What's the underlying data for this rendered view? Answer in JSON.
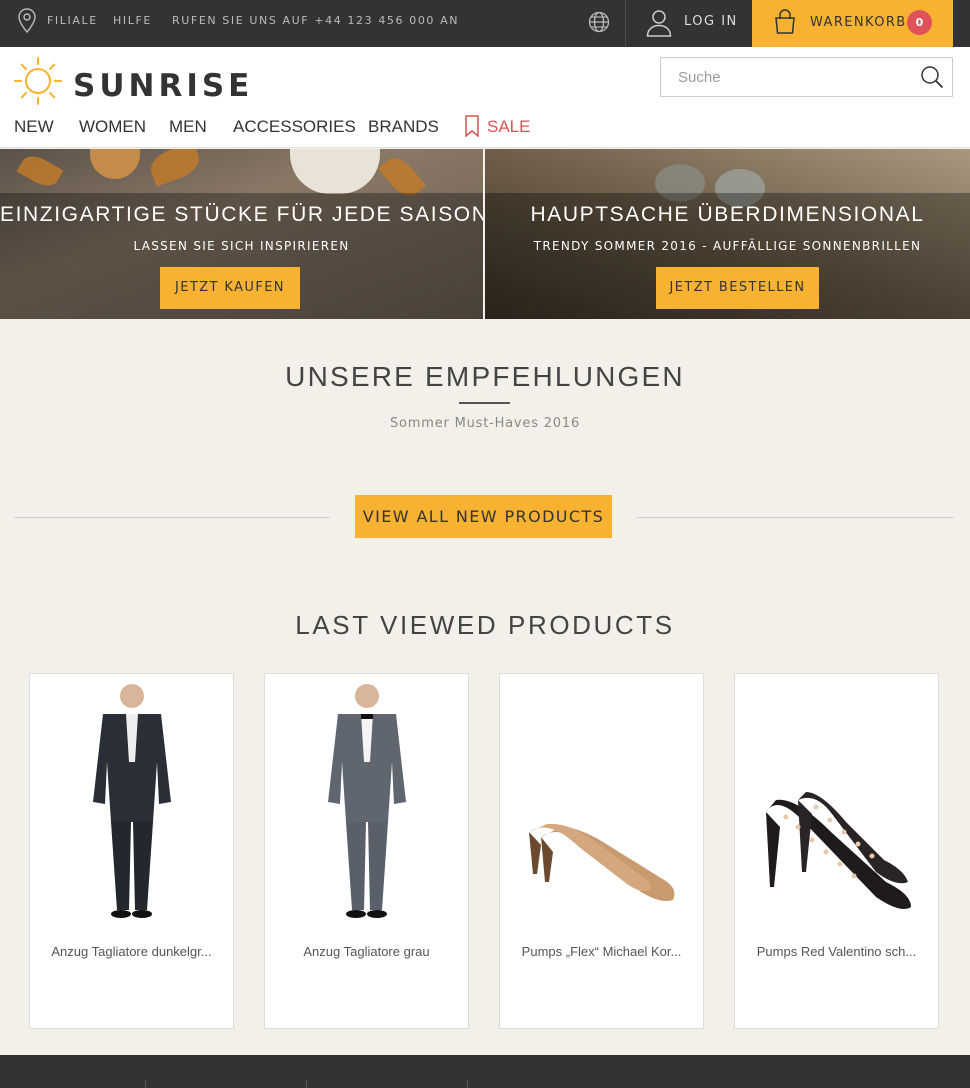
{
  "topbar": {
    "store_label": "FILIALE",
    "help_label": "HILFE",
    "phone_label": "RUFEN SIE UNS AUF +44 123 456 000 AN",
    "login_label": "LOG IN",
    "cart_label": "WARENKORB",
    "cart_count": "0"
  },
  "brand": {
    "name": "SUNRISE"
  },
  "search": {
    "placeholder": "Suche"
  },
  "nav": {
    "items": [
      "NEW",
      "WOMEN",
      "MEN",
      "ACCESSORIES",
      "BRANDS"
    ],
    "sale_label": "SALE"
  },
  "hero": [
    {
      "title": "EINZIGARTIGE STÜCKE FÜR JEDE SAISON",
      "subtitle": "LASSEN SIE SICH INSPIRIEREN",
      "button": "JETZT KAUFEN"
    },
    {
      "title": "HAUPTSACHE ÜBERDIMENSIONAL",
      "subtitle": "TRENDY SOMMER 2016 - AUFFÄLLIGE SONNENBRILLEN",
      "button": "JETZT BESTELLEN"
    }
  ],
  "recommendations": {
    "title": "UNSERE EMPFEHLUNGEN",
    "subtitle": "Sommer Must-Haves 2016",
    "button": "VIEW ALL NEW PRODUCTS"
  },
  "last_viewed": {
    "title": "LAST VIEWED PRODUCTS",
    "products": [
      {
        "name": "Anzug Tagliatore dunkelgr..."
      },
      {
        "name": "Anzug Tagliatore grau"
      },
      {
        "name": "Pumps „Flex“ Michael Kor..."
      },
      {
        "name": "Pumps Red Valentino sch..."
      }
    ]
  },
  "colors": {
    "accent": "#f7b232",
    "dark": "#333333",
    "sale": "#d9534f",
    "badge": "#e0525a",
    "background": "#f3f0ea"
  }
}
